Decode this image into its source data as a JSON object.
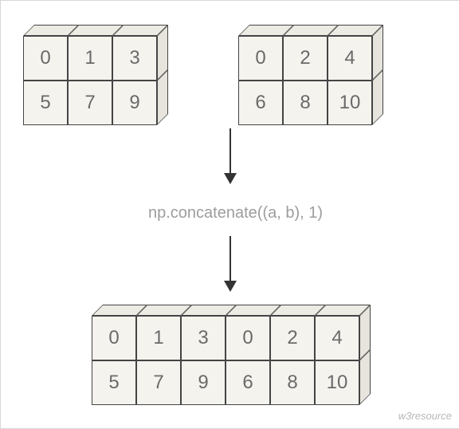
{
  "arrays": {
    "a": [
      [
        0,
        1,
        3
      ],
      [
        5,
        7,
        9
      ]
    ],
    "b": [
      [
        0,
        2,
        4
      ],
      [
        6,
        8,
        10
      ]
    ],
    "result": [
      [
        0,
        1,
        3,
        0,
        2,
        4
      ],
      [
        5,
        7,
        9,
        6,
        8,
        10
      ]
    ]
  },
  "operation_label": "np.concatenate((a, b), 1)",
  "watermark": "w3resource"
}
